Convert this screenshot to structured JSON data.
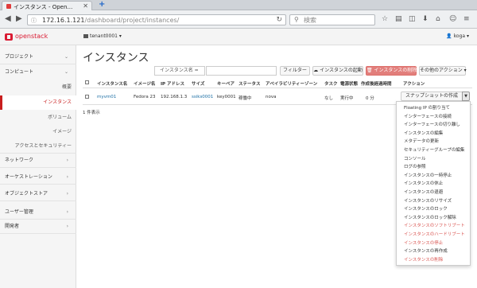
{
  "browser": {
    "tab_title": "インスタンス - Open…",
    "tab_close": "✕",
    "new_tab": "+",
    "url_base": "172.16.1.121",
    "url_path": "/dashboard/project/instances/",
    "search_placeholder": "検索"
  },
  "header": {
    "logo_text": "openstack",
    "project": "tenant0001 ▾",
    "user": "👤 koga ▾"
  },
  "sidebar": {
    "project": "プロジェクト",
    "compute": "コンピュート",
    "overview": "概要",
    "instances": "インスタンス",
    "volumes": "ボリューム",
    "images": "イメージ",
    "access": "アクセスとセキュリティー",
    "network": "ネットワーク",
    "orchestration": "オーケストレーション",
    "object_store": "オブジェクトストア",
    "user_admin": "ユーザー管理",
    "developer": "開発者"
  },
  "main": {
    "title": "インスタンス",
    "filter_select": "インスタンス名 =",
    "filter_btn": "フィルター",
    "launch_btn": "☁ インスタンスの起動",
    "delete_btn": "🗑 インスタンスの削除",
    "more_btn": "その他のアクション ▾"
  },
  "table": {
    "headers": [
      "インスタンス名",
      "イメージ名",
      "IP アドレス",
      "サイズ",
      "キーペア",
      "ステータス",
      "アベイラビリティーゾーン",
      "タスク",
      "電源状態",
      "作成後経過時間",
      "アクション"
    ],
    "row": {
      "name": "myvm01",
      "image": "Fedora 23",
      "ip": "192.168.1.3",
      "size": "ssiks0001",
      "keypair": "key0001",
      "status": "稼働中",
      "az": "nova",
      "task": "なし",
      "power": "実行中",
      "age": "0 分",
      "action": "スナップショットの作成"
    },
    "footer": "1 件表示"
  },
  "dropdown": [
    {
      "label": "Floating IP の割り当て",
      "danger": false
    },
    {
      "label": "インターフェースの接続",
      "danger": false
    },
    {
      "label": "インターフェースの切り離し",
      "danger": false
    },
    {
      "label": "インスタンスの編集",
      "danger": false
    },
    {
      "label": "メタデータの更新",
      "danger": false
    },
    {
      "label": "セキュリティーグループの編集",
      "danger": false
    },
    {
      "label": "コンソール",
      "danger": false
    },
    {
      "label": "ログの参照",
      "danger": false
    },
    {
      "label": "インスタンスの一時停止",
      "danger": false
    },
    {
      "label": "インスタンスの休止",
      "danger": false
    },
    {
      "label": "インスタンスの退避",
      "danger": false
    },
    {
      "label": "インスタンスのリサイズ",
      "danger": false
    },
    {
      "label": "インスタンスのロック",
      "danger": false
    },
    {
      "label": "インスタンスのロック解除",
      "danger": false
    },
    {
      "label": "インスタンスのソフトリブート",
      "danger": true
    },
    {
      "label": "インスタンスのハードリブート",
      "danger": true
    },
    {
      "label": "インスタンスの停止",
      "danger": true
    },
    {
      "label": "インスタンスの再作成",
      "danger": false
    },
    {
      "label": "インスタンスの削除",
      "danger": true
    }
  ],
  "colors": {
    "accent_red": "#da1a32",
    "link_blue": "#1d6fa5",
    "danger": "#d9534f"
  }
}
